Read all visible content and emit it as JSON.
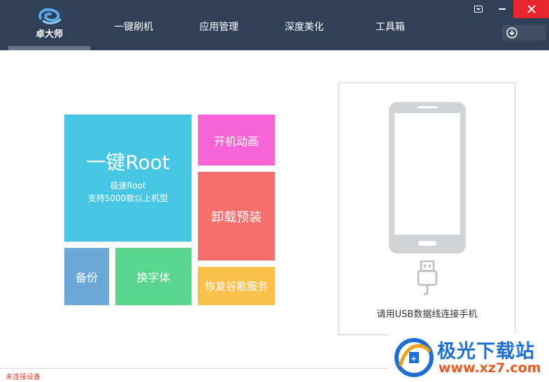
{
  "app": {
    "logo_text": "卓大师"
  },
  "nav": {
    "items": [
      {
        "label": "一键刷机"
      },
      {
        "label": "应用管理"
      },
      {
        "label": "深度美化"
      },
      {
        "label": "工具箱"
      }
    ]
  },
  "window_controls": {
    "menu_icon": "menu-dropdown-icon",
    "minimize_icon": "minimize-icon",
    "close_icon": "close-icon",
    "download_icon": "download-icon"
  },
  "tiles": {
    "root": {
      "title": "一键Root",
      "line1": "极速Root",
      "line2": "支持5000款以上机型",
      "color": "#47c6e3"
    },
    "boot_animation": {
      "label": "开机动画",
      "color": "#f764d5"
    },
    "uninstall_preinstalled": {
      "label": "卸载预装",
      "color": "#f76f6c"
    },
    "backup": {
      "label": "备份",
      "color": "#6ba8d8"
    },
    "change_font": {
      "label": "换字体",
      "color": "#5ad58d"
    },
    "restore_google": {
      "label": "恢复谷歌服务",
      "color": "#f9c04b"
    }
  },
  "device_panel": {
    "hint": "请用USB数据线连接手机",
    "phone_icon": "phone-icon",
    "usb_icon": "usb-cable-icon"
  },
  "status": {
    "text": "未连接设备",
    "color": "#e0403a"
  },
  "watermark": {
    "title": "极光下载站",
    "url": "www.xz7.com"
  },
  "colors": {
    "header_bg": "#2f4058",
    "close_bg": "#e8242f"
  }
}
